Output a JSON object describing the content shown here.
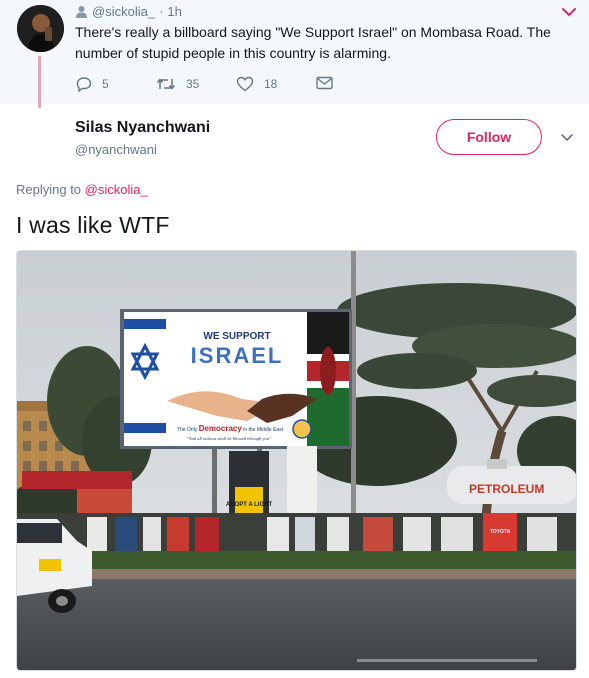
{
  "parent_tweet": {
    "handle": "@sickolia_",
    "separator": "·",
    "time": "1h",
    "text": "There's really a billboard saying \"We Support Israel\" on Mombasa Road. The number of stupid people in this country is alarming.",
    "actions": {
      "reply_count": "5",
      "retweet_count": "35",
      "like_count": "18"
    },
    "icons": [
      "user-icon",
      "chevron-down-icon",
      "reply-icon",
      "retweet-icon",
      "heart-icon",
      "envelope-icon"
    ]
  },
  "main_tweet": {
    "author_name": "Silas Nyanchwani",
    "author_handle": "@nyanchwani",
    "follow_label": "Follow",
    "replying_prefix": "Replying to",
    "replying_to": "@sickolia_",
    "text": "I was like WTF"
  },
  "photo": {
    "billboard": {
      "line1": "WE SUPPORT",
      "line2": "ISRAEL",
      "tagline_prefix": "The Only",
      "tagline_highlight": "Democracy",
      "tagline_suffix": "in the Middle East",
      "verse": "\"And all nations shall be blessed through you\""
    },
    "side_sign": "ADOPT A LIGHT",
    "truck_text": "PETROLEUM",
    "small_sign": "TOYOTA"
  },
  "colors": {
    "accent": "#e0245e",
    "muted": "#657786",
    "text": "#14171a",
    "parent_bg": "#f5f8fa"
  }
}
